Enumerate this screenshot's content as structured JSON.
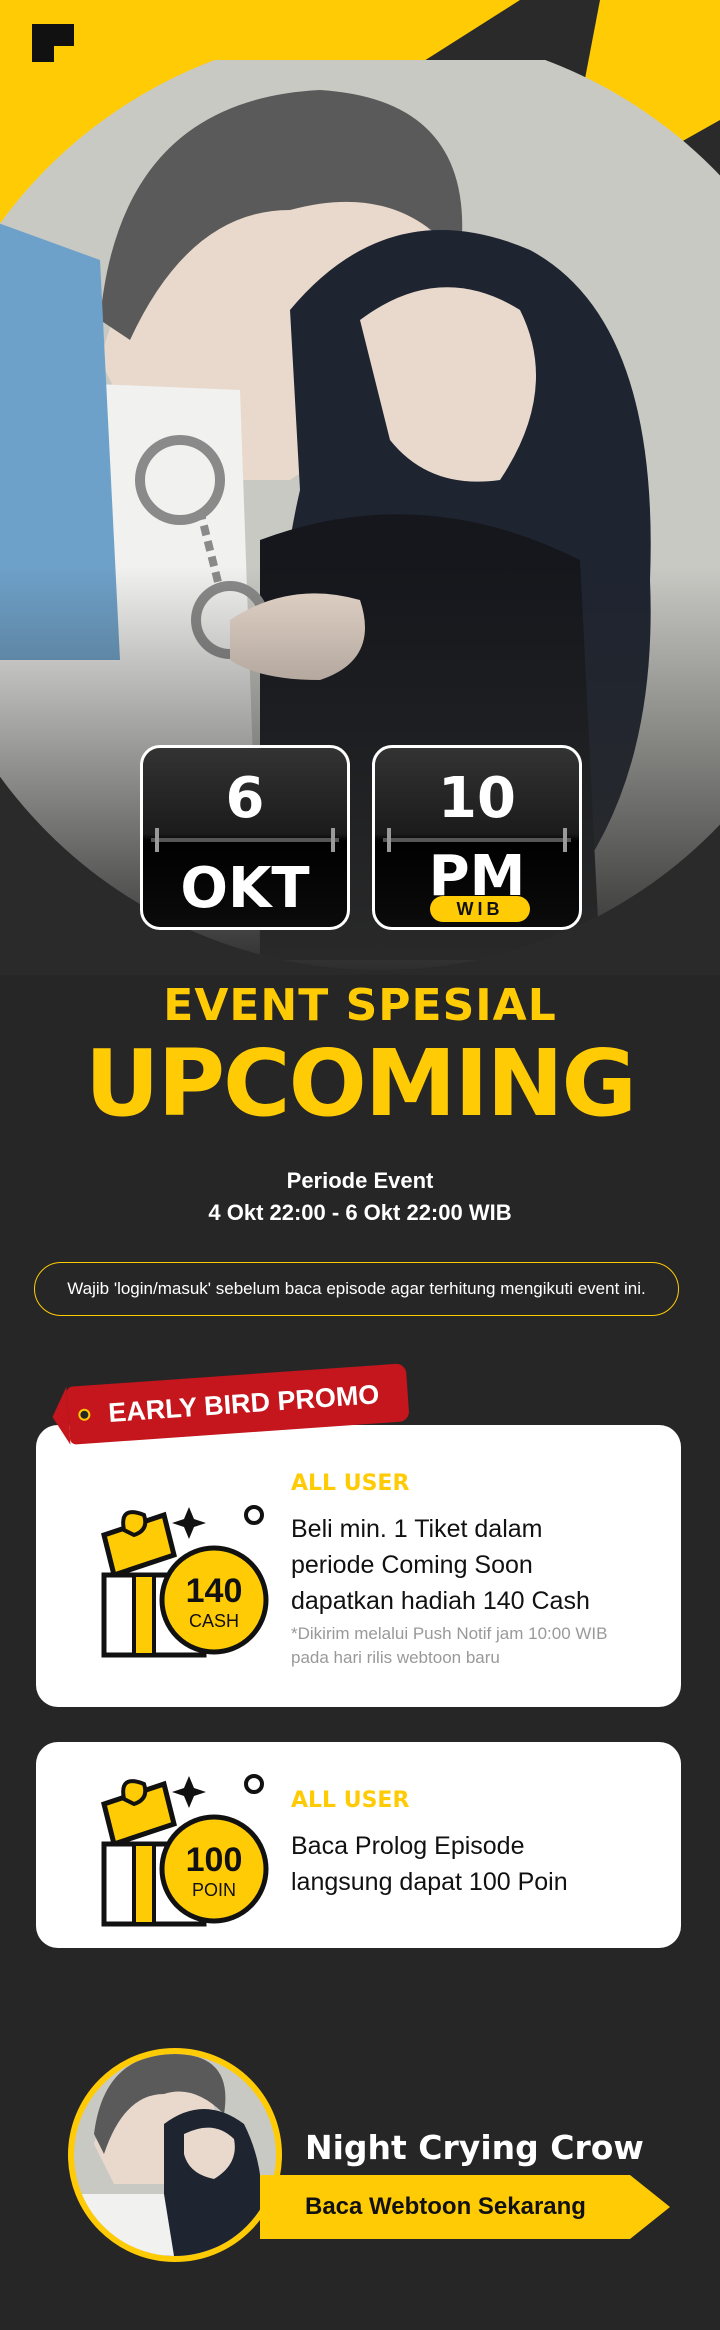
{
  "date": {
    "day": "6",
    "month": "OKT",
    "hour": "10",
    "ampm": "PM",
    "timezone": "WIB"
  },
  "event": {
    "subtitle": "EVENT SPESIAL",
    "title": "UPCOMING"
  },
  "period": {
    "label": "Periode Event",
    "range": "4 Okt 22:00 - 6 Okt 22:00 WIB"
  },
  "notice": "Wajib 'login/masuk' sebelum baca episode agar terhitung mengikuti event ini.",
  "ribbon": "EARLY BIRD PROMO",
  "cards": [
    {
      "tag": "ALL USER",
      "desc_lines": [
        "Beli min. 1 Tiket dalam",
        "periode Coming Soon",
        "dapatkan hadiah 140 Cash"
      ],
      "note_lines": [
        "*Dikirim melalui Push Notif jam 10:00 WIB",
        "pada hari rilis webtoon baru"
      ],
      "amount": "140",
      "unit": "CASH"
    },
    {
      "tag": "ALL USER",
      "desc_lines": [
        "Baca Prolog Episode",
        "langsung dapat 100 Poin"
      ],
      "amount": "100",
      "unit": "POIN"
    }
  ],
  "promo": {
    "title": "Night Crying Crow",
    "button": "Baca Webtoon Sekarang"
  },
  "colors": {
    "accent": "#ffcb05",
    "ribbon": "#c4161c",
    "background": "#262626"
  }
}
